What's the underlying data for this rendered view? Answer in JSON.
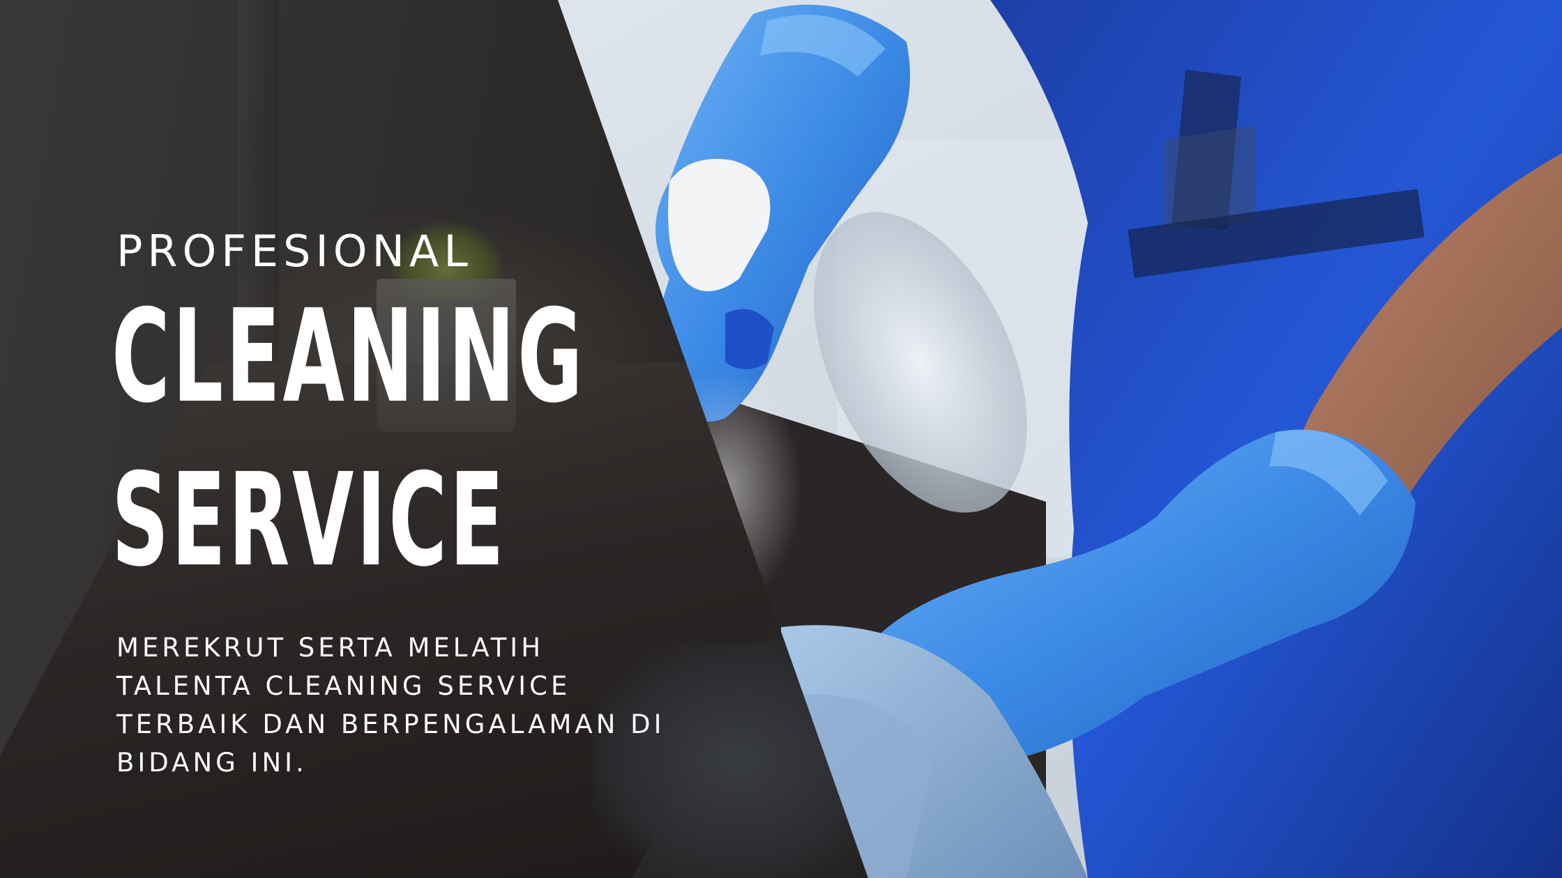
{
  "banner": {
    "subtitle": "PROFESIONAL",
    "headline_line1": "CLEANING",
    "headline_line2": "SERVICE",
    "body_lines": [
      "MEREKRUT SERTA MELATIH",
      "TALENTA CLEANING SERVICE",
      "TERBAIK DAN BERPENGALAMAN DI",
      "BIDANG INI."
    ]
  },
  "colors": {
    "text": "#ffffff",
    "dark_panel": "#2a2827",
    "uniform_blue": "#1f4fc9",
    "glove_blue": "#3f8fe8"
  },
  "icons": {
    "photo": "cleaner-spraying-and-wiping-photo"
  }
}
